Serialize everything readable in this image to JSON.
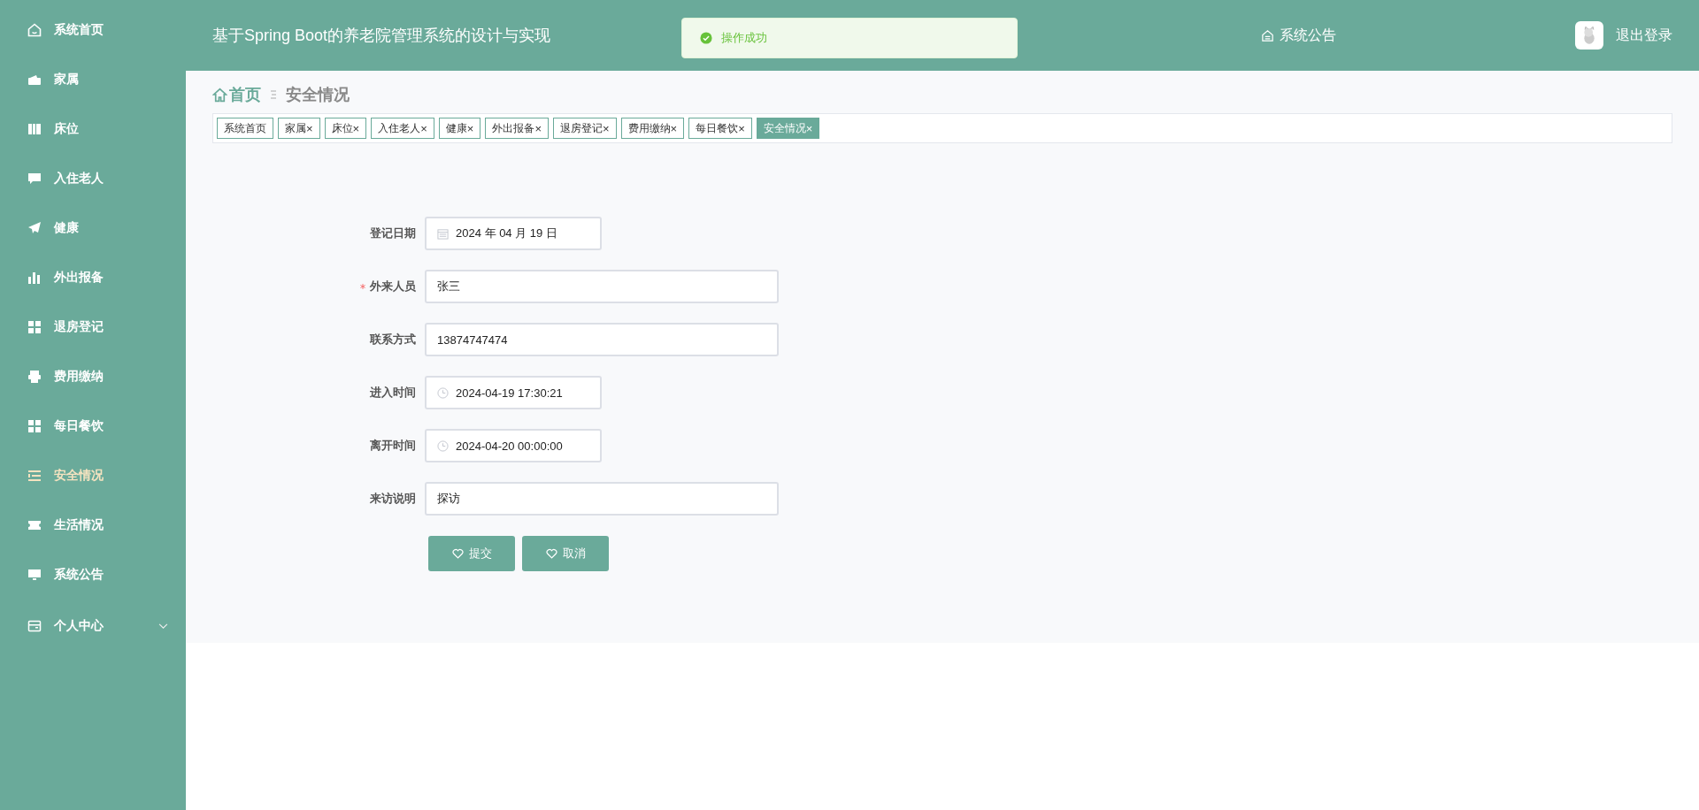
{
  "sidebar": {
    "items": [
      {
        "label": "系统首页",
        "selected": false,
        "kind": "link"
      },
      {
        "label": "家属",
        "selected": false,
        "kind": "link"
      },
      {
        "label": "床位",
        "selected": false,
        "kind": "link"
      },
      {
        "label": "入住老人",
        "selected": false,
        "kind": "link"
      },
      {
        "label": "健康",
        "selected": false,
        "kind": "link"
      },
      {
        "label": "外出报备",
        "selected": false,
        "kind": "link"
      },
      {
        "label": "退房登记",
        "selected": false,
        "kind": "link"
      },
      {
        "label": "费用缴纳",
        "selected": false,
        "kind": "link"
      },
      {
        "label": "每日餐饮",
        "selected": false,
        "kind": "link"
      },
      {
        "label": "安全情况",
        "selected": true,
        "kind": "link"
      },
      {
        "label": "生活情况",
        "selected": false,
        "kind": "link"
      },
      {
        "label": "系统公告",
        "selected": false,
        "kind": "link"
      },
      {
        "label": "个人中心",
        "selected": false,
        "kind": "submenu",
        "expanded": false
      }
    ]
  },
  "header": {
    "title": "基于Spring Boot的养老院管理系统的设计与实现",
    "notice_link": "系统公告",
    "logout": "退出登录"
  },
  "toast": {
    "message": "操作成功"
  },
  "breadcrumb": {
    "home": "首页",
    "current": "安全情况"
  },
  "tabs": [
    {
      "label": "系统首页",
      "selected": false
    },
    {
      "label": "家属",
      "close": "×",
      "selected": false
    },
    {
      "label": "床位",
      "close": "×",
      "selected": false
    },
    {
      "label": "入住老人",
      "close": "×",
      "selected": false
    },
    {
      "label": "健康",
      "close": "×",
      "selected": false
    },
    {
      "label": "外出报备",
      "close": "×",
      "selected": false
    },
    {
      "label": "退房登记",
      "close": "×",
      "selected": false
    },
    {
      "label": "费用缴纳",
      "close": "×",
      "selected": false
    },
    {
      "label": "每日餐饮",
      "close": "×",
      "selected": false
    },
    {
      "label": "安全情况",
      "close": "×",
      "selected": true
    }
  ],
  "form": {
    "fields": [
      {
        "label": "登记日期",
        "value": "2024 年 04 月 19 日",
        "kind": "date",
        "required": false
      },
      {
        "label": "外来人员",
        "value": "张三",
        "kind": "text",
        "required": true
      },
      {
        "label": "联系方式",
        "value": "13874747474",
        "kind": "text",
        "required": false
      },
      {
        "label": "进入时间",
        "value": "2024-04-19 17:30:21",
        "kind": "time",
        "required": false
      },
      {
        "label": "离开时间",
        "value": "2024-04-20 00:00:00",
        "kind": "time",
        "required": false
      },
      {
        "label": "来访说明",
        "value": "探访",
        "kind": "text",
        "required": false
      }
    ],
    "buttons": [
      {
        "label": "提交"
      },
      {
        "label": "取消"
      }
    ]
  }
}
